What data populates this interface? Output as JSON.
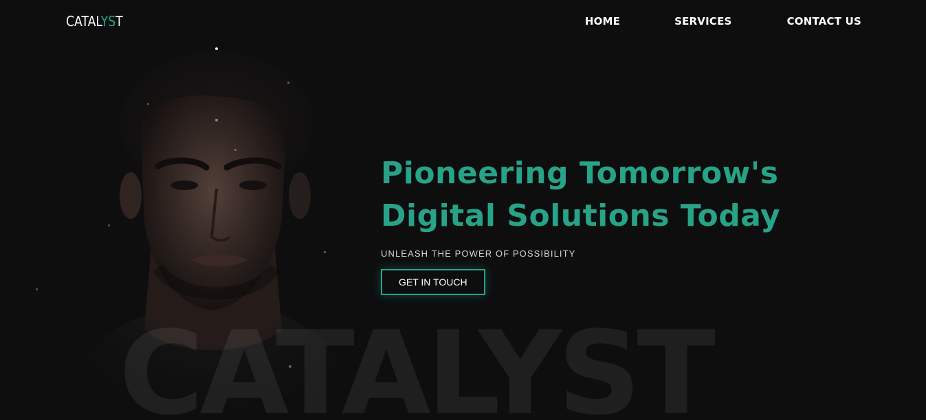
{
  "brand": {
    "logo_prefix": "CATAL",
    "logo_accent": "YS",
    "logo_suffix": "T",
    "accent_color": "#27a388",
    "background_color": "#0e0e0f"
  },
  "nav": {
    "items": [
      {
        "label": "HOME"
      },
      {
        "label": "SERVICES"
      },
      {
        "label": "CONTACT US"
      }
    ]
  },
  "hero": {
    "headline_line1": "Pioneering Tomorrow's",
    "headline_line2": "Digital Solutions Today",
    "subtitle": "UNLEASH THE POWER OF POSSIBILITY",
    "cta_label": "GET IN TOUCH",
    "watermark": "CATALYST"
  }
}
